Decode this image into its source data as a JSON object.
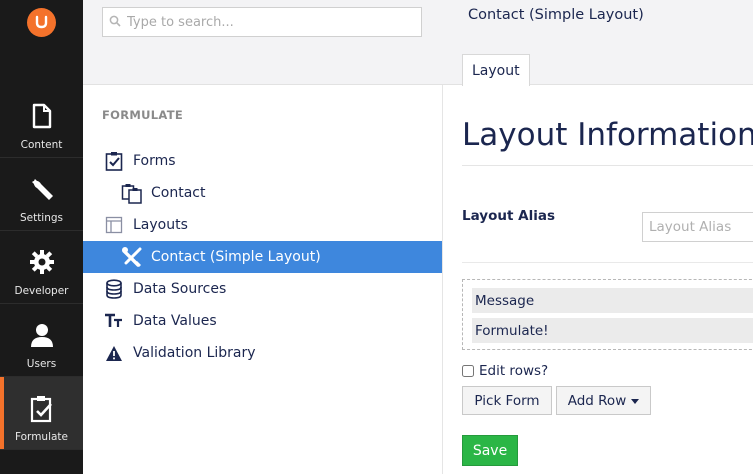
{
  "appbar": {
    "items": [
      {
        "label": "Content",
        "icon": "document-icon"
      },
      {
        "label": "Settings",
        "icon": "wrench-icon"
      },
      {
        "label": "Developer",
        "icon": "gear-icon"
      },
      {
        "label": "Users",
        "icon": "user-icon"
      },
      {
        "label": "Formulate",
        "icon": "clipboard-check-icon",
        "active": true
      }
    ],
    "accent": "#f4722b"
  },
  "tree": {
    "search_placeholder": "Type to search...",
    "section_title": "FORMULATE",
    "nodes": [
      {
        "label": "Forms",
        "icon": "clipboard-check-icon",
        "level": 1
      },
      {
        "label": "Contact",
        "icon": "clipboards-icon",
        "level": 2
      },
      {
        "label": "Layouts",
        "icon": "layout-icon",
        "level": 1
      },
      {
        "label": "Contact (Simple Layout)",
        "icon": "tools-icon",
        "level": 2,
        "selected": true
      },
      {
        "label": "Data Sources",
        "icon": "database-icon",
        "level": 1
      },
      {
        "label": "Data Values",
        "icon": "text-size-icon",
        "level": 1
      },
      {
        "label": "Validation Library",
        "icon": "warning-icon",
        "level": 1
      }
    ],
    "selected_color": "#3e87dd"
  },
  "editor": {
    "title": "Contact (Simple Layout)",
    "tab_label": "Layout",
    "heading": "Layout Information",
    "alias_label": "Layout Alias",
    "alias_placeholder": "Layout Alias",
    "rows": [
      "Message",
      "Formulate!"
    ],
    "edit_rows_label": "Edit rows?",
    "pick_form_label": "Pick Form",
    "add_row_label": "Add Row",
    "save_label": "Save",
    "save_color": "#2bb646"
  }
}
